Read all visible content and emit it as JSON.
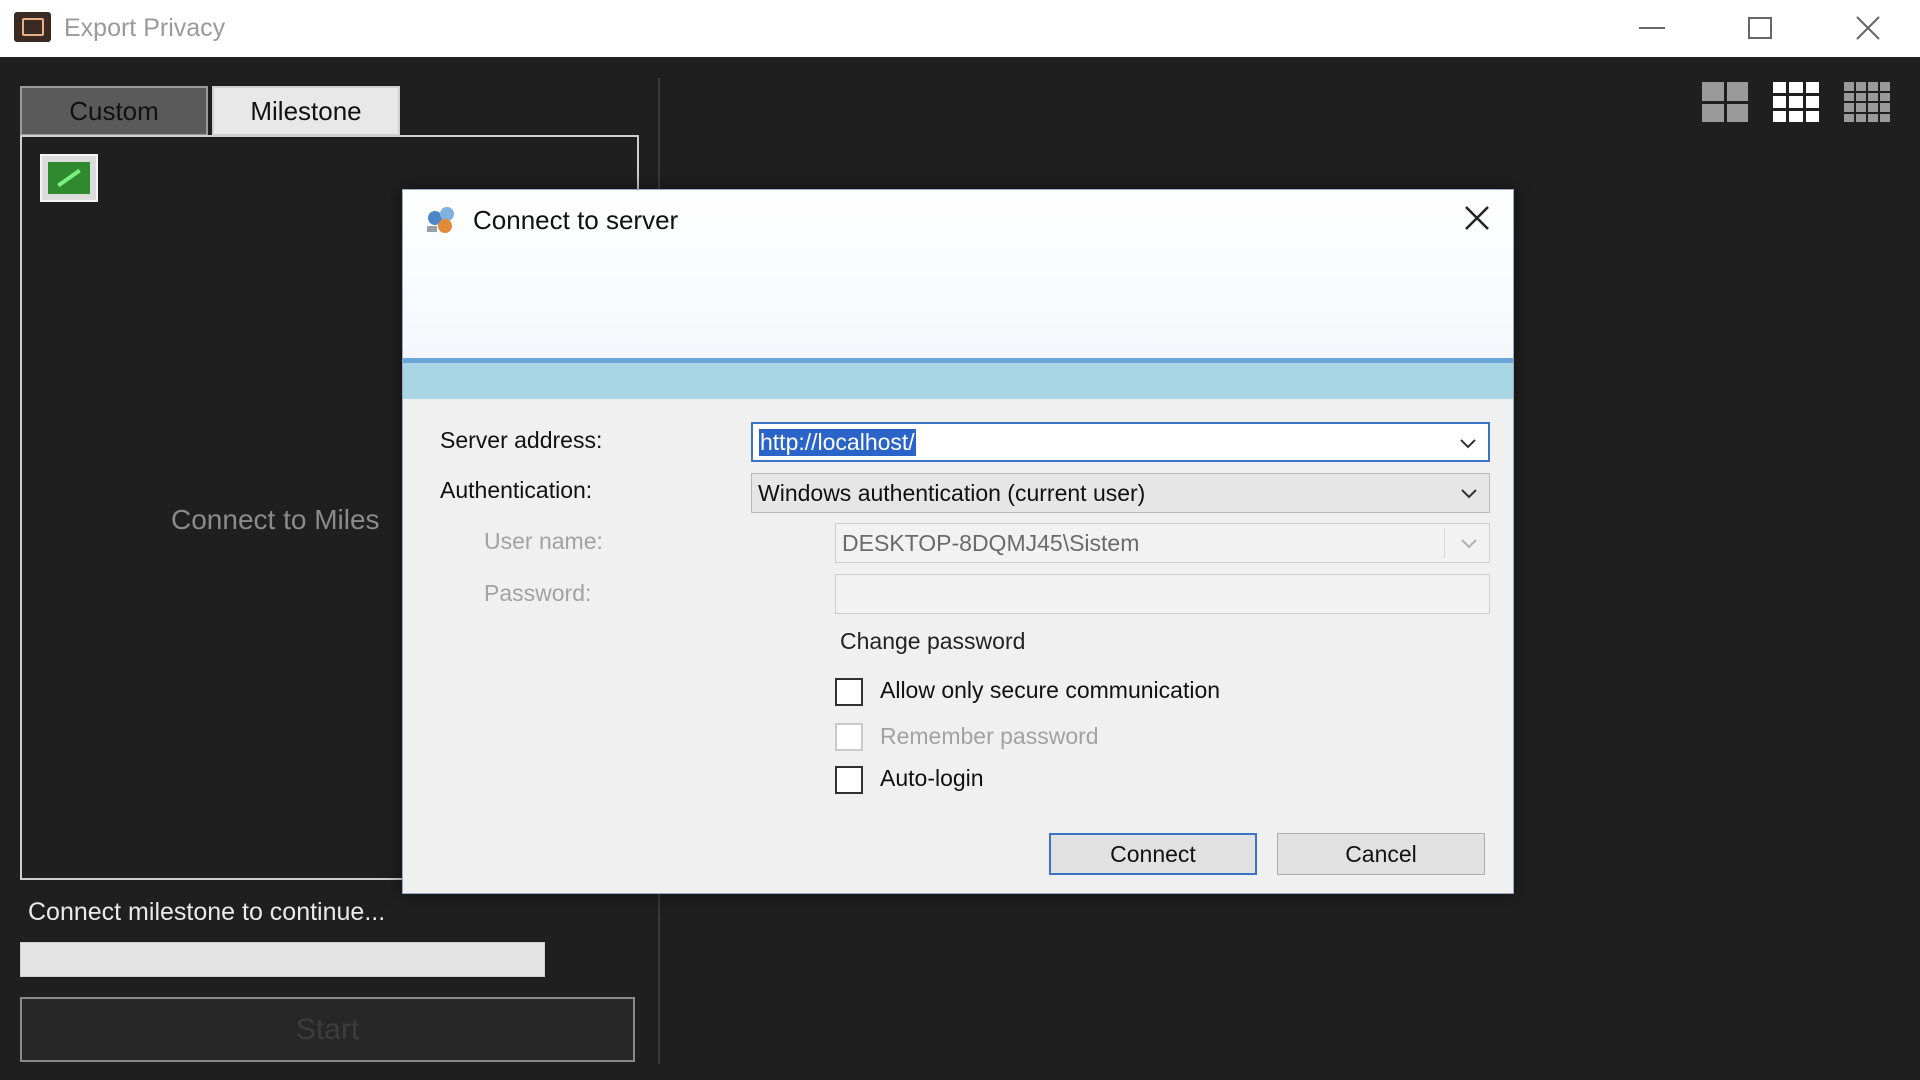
{
  "window": {
    "title": "Export Privacy"
  },
  "tabs": [
    {
      "label": "Custom",
      "state": "inactive"
    },
    {
      "label": "Milestone",
      "state": "active"
    }
  ],
  "left_panel": {
    "connect_hint": "Connect to Miles",
    "status_text": "Connect milestone to continue...",
    "start_label": "Start"
  },
  "layout_buttons": [
    {
      "icon": "grid-2x2-icon"
    },
    {
      "icon": "grid-3x3-icon"
    },
    {
      "icon": "grid-4x4-icon"
    }
  ],
  "dialog": {
    "title": "Connect to server",
    "server_address_label": "Server address:",
    "server_address_value": "http://localhost/",
    "authentication_label": "Authentication:",
    "authentication_value": "Windows authentication (current user)",
    "user_name_label": "User name:",
    "user_name_value": "DESKTOP-8DQMJ45\\Sistem",
    "password_label": "Password:",
    "password_value": "",
    "change_password_label": "Change password",
    "secure_label": "Allow only secure communication",
    "secure_checked": false,
    "remember_label": "Remember password",
    "remember_checked": false,
    "autologin_label": "Auto-login",
    "autologin_checked": false,
    "connect_label": "Connect",
    "cancel_label": "Cancel"
  },
  "colors": {
    "background": "#1f1f1f",
    "dialog_accent": "#6aa7d8",
    "dialog_band": "#a9d6e4",
    "selection": "#2a64c8"
  }
}
